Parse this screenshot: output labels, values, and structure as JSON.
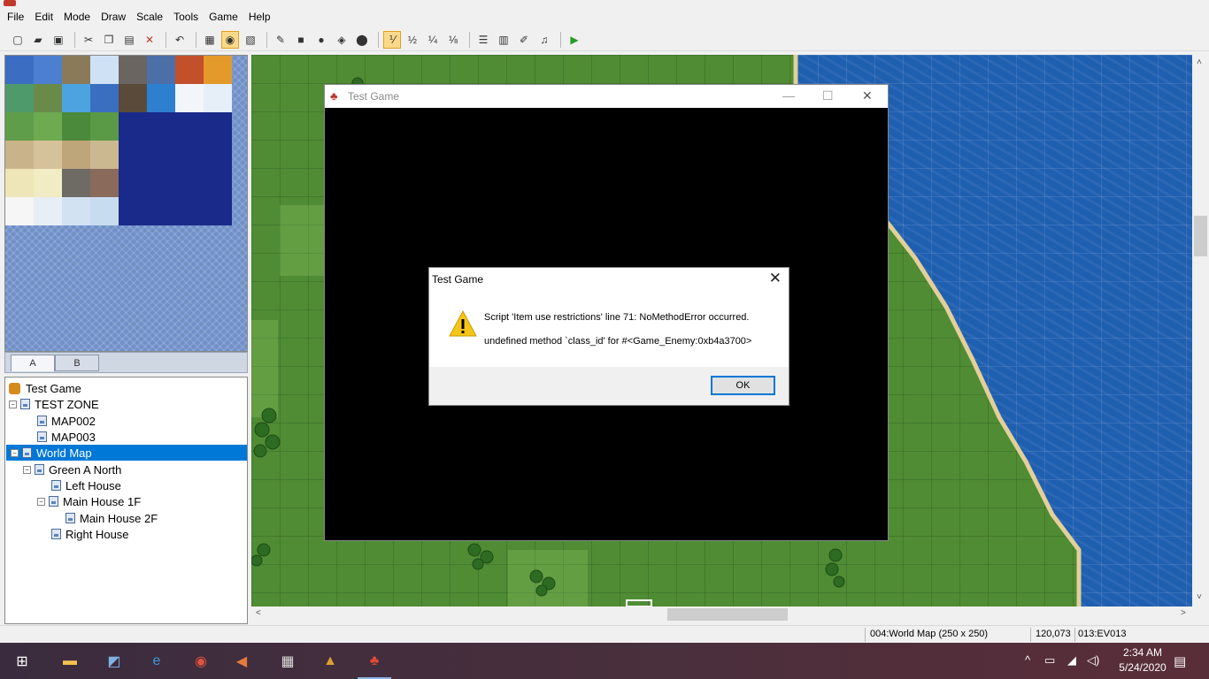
{
  "menu": [
    "File",
    "Edit",
    "Mode",
    "Draw",
    "Scale",
    "Tools",
    "Game",
    "Help"
  ],
  "toolbar": {
    "icons": [
      "new-project-icon",
      "open-project-icon",
      "save-icon",
      "sep",
      "cut-icon",
      "copy-icon",
      "paste-icon",
      "delete-icon",
      "sep",
      "undo-icon",
      "sep",
      "layer-lower-icon",
      "layer-upper-icon",
      "event-layer-icon",
      "sep",
      "pencil-icon",
      "rectangle-icon",
      "ellipse-icon",
      "fill-icon",
      "shadow-pen-icon",
      "sep",
      "zoom-1-1-icon",
      "zoom-1-2-icon",
      "zoom-1-4-icon",
      "zoom-1-8-icon",
      "sep",
      "database-icon",
      "resource-manager-icon",
      "script-editor-icon",
      "sound-test-icon",
      "sep",
      "play-test-icon"
    ],
    "glyphs": [
      "▢",
      "▰",
      "▣",
      "",
      "✂",
      "❐",
      "▤",
      "✕",
      "",
      "↶",
      "",
      "▦",
      "◉",
      "▧",
      "",
      "✎",
      "■",
      "●",
      "◈",
      "⬤",
      "",
      "⅟",
      "½",
      "¼",
      "⅛",
      "",
      "☰",
      "▥",
      "✐",
      "♫",
      "",
      "▶"
    ],
    "active": [
      "layer-upper-icon",
      "zoom-1-1-icon"
    ]
  },
  "tileset": {
    "tabs": [
      "A",
      "B"
    ],
    "tiles": [
      "#3b6ec2",
      "#4c7fcf",
      "#8a7a5a",
      "#cfe2f5",
      "#6a6560",
      "#4c6fa8",
      "#c2502a",
      "#e39a2a",
      "#4e9a6a",
      "#6a8a4a",
      "#4da3e0",
      "#3a6fc0",
      "#5a4a3a",
      "#2d7fd0",
      "#f2f6fb",
      "#e6eef8",
      "#5e9e4a",
      "#6eaa50",
      "#4a8a3a",
      "#5a9a46",
      "#1a2a8a",
      "#1a2a8a",
      "#1a2a8a",
      "#1a2a8a",
      "#c9b48a",
      "#d6c29a",
      "#bfa57a",
      "#cbb890",
      "#1a2a8a",
      "#1a2a8a",
      "#1a2a8a",
      "#1a2a8a",
      "#eee6b8",
      "#f2ecc4",
      "#6e6a64",
      "#8a6a5a",
      "#1a2a8a",
      "#1a2a8a",
      "#1a2a8a",
      "#1a2a8a",
      "#f6f6f6",
      "#e8eef6",
      "#d2e2f2",
      "#c8dcf0",
      "#1a2a8a",
      "#1a2a8a",
      "#1a2a8a",
      "#1a2a8a"
    ]
  },
  "maptree": {
    "root": "Test Game",
    "nodes": [
      {
        "label": "TEST ZONE",
        "expander": "⊟"
      },
      {
        "label": "MAP002",
        "expander": ""
      },
      {
        "label": "MAP003",
        "expander": ""
      },
      {
        "label": "World Map",
        "expander": "⊟"
      },
      {
        "label": "Green A North",
        "expander": "⊟"
      },
      {
        "label": "Left House",
        "expander": ""
      },
      {
        "label": "Main House 1F",
        "expander": "⊟"
      },
      {
        "label": "Main House 2F",
        "expander": ""
      },
      {
        "label": "Right House",
        "expander": ""
      }
    ]
  },
  "status": {
    "map": "004:World Map (250 x 250)",
    "coords": "120,073",
    "event": "013:EV013"
  },
  "gamewindow": {
    "title": "Test Game",
    "minimize": "—",
    "maximize": "☐",
    "close": "✕"
  },
  "dialog": {
    "title": "Test Game",
    "close": "✕",
    "line1": "Script 'Item use restrictions' line 71: NoMethodError occurred.",
    "line2": "undefined method `class_id' for #<Game_Enemy:0xb4a3700>",
    "ok": "OK"
  },
  "scroll": {
    "up": "˄",
    "down": "˅",
    "left": "<",
    "right": ">"
  },
  "taskbar": {
    "apps": [
      "start-icon",
      "file-explorer-icon",
      "notepad-icon",
      "edge-icon",
      "chrome-icon",
      "media-icon",
      "calculator-icon",
      "rpgmaker-icon",
      "game-icon"
    ],
    "glyphs": [
      "⊞",
      "▬",
      "◩",
      "e",
      "◉",
      "◀",
      "▦",
      "▲",
      "♣"
    ],
    "glyph_colors": [
      "#ffffff",
      "#f2c14e",
      "#7fb2e5",
      "#3a9be0",
      "#e0533c",
      "#e67a3c",
      "#dddddd",
      "#e0a030",
      "#e04a3a"
    ],
    "tray_glyphs": [
      "^",
      "▭",
      "◢",
      "◁)",
      "▤"
    ],
    "time": "2:34 AM",
    "date": "5/24/2020"
  }
}
